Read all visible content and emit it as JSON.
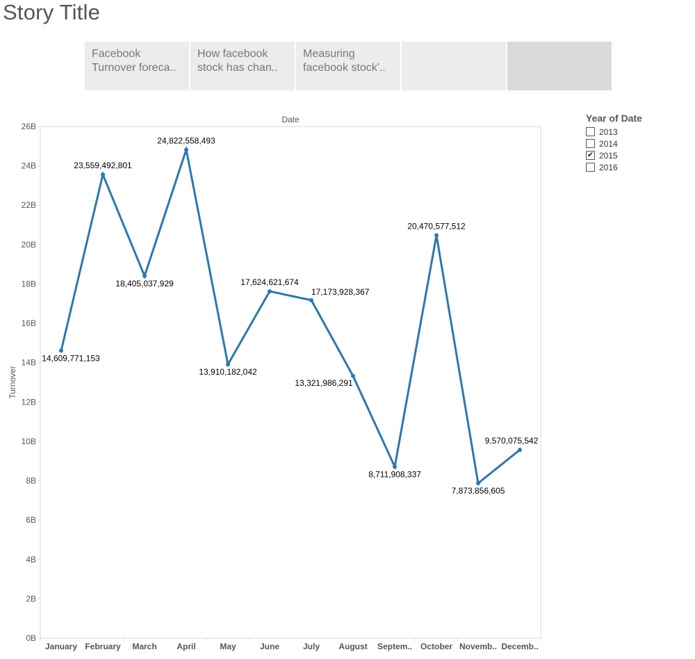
{
  "story": {
    "title": "Story Title",
    "points": [
      {
        "line1": "Facebook",
        "line2": "Turnover foreca..",
        "active": false
      },
      {
        "line1": "How facebook",
        "line2": "stock has chan..",
        "active": false
      },
      {
        "line1": "Measuring",
        "line2": "facebook stock'..",
        "active": false
      },
      {
        "line1": "",
        "line2": "",
        "active": false
      },
      {
        "line1": "",
        "line2": "",
        "active": true
      }
    ]
  },
  "legend": {
    "title": "Year of Date",
    "items": [
      {
        "label": "2013",
        "checked": false
      },
      {
        "label": "2014",
        "checked": false
      },
      {
        "label": "2015",
        "checked": true
      },
      {
        "label": "2016",
        "checked": false
      }
    ]
  },
  "colors": {
    "line": "#2a78b0",
    "grid_border": "#d8d8d8",
    "axis_text": "#555555",
    "label_text": "#000000"
  },
  "chart_data": {
    "type": "line",
    "title": "Date",
    "xlabel": "",
    "ylabel": "Turnover",
    "categories": [
      "January",
      "February",
      "March",
      "April",
      "May",
      "June",
      "July",
      "August",
      "Septem..",
      "October",
      "Novemb..",
      "Decemb.."
    ],
    "series": [
      {
        "values": [
          14609771153,
          23559492801,
          18405037929,
          24822558493,
          13910182042,
          17624621674,
          17173928367,
          13321986291,
          8711908337,
          20470577512,
          7873856605,
          9570075542
        ],
        "labels": [
          "14,609,771,153",
          "23,559,492,801",
          "18,405,037,929",
          "24,822,558,493",
          "13,910,182,042",
          "17,624,621,674",
          "17,173,928,367",
          "13,321,986,291",
          "8,711,908,337",
          "20,470,577,512",
          "7,873,856,605",
          "9,570,075,542"
        ]
      }
    ],
    "ylim": [
      0,
      26000000000
    ],
    "yticks": [
      0,
      2000000000,
      4000000000,
      6000000000,
      8000000000,
      10000000000,
      12000000000,
      14000000000,
      16000000000,
      18000000000,
      20000000000,
      22000000000,
      24000000000,
      26000000000
    ],
    "ytick_labels": [
      "0B",
      "2B",
      "4B",
      "6B",
      "8B",
      "10B",
      "12B",
      "14B",
      "16B",
      "18B",
      "20B",
      "22B",
      "24B",
      "26B"
    ],
    "grid": false,
    "legend": "none"
  }
}
